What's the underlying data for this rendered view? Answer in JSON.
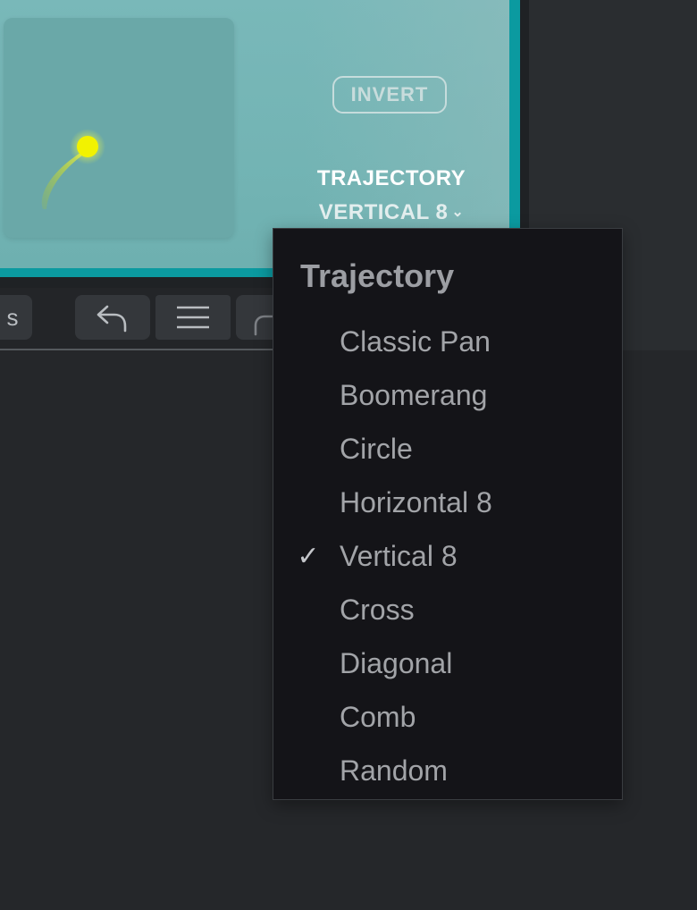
{
  "panel": {
    "invert_label": "INVERT",
    "trajectory_label": "TRAJECTORY",
    "trajectory_value": "VERTICAL 8",
    "chevron": "⌄"
  },
  "toolbar": {
    "left_button_text": "s",
    "icons": [
      "undo-arrow-icon",
      "hamburger-menu-icon",
      "curve-icon"
    ]
  },
  "dropdown": {
    "title": "Trajectory",
    "selected": "Vertical 8",
    "check_glyph": "✓",
    "items": [
      {
        "label": "Classic Pan"
      },
      {
        "label": "Boomerang"
      },
      {
        "label": "Circle"
      },
      {
        "label": "Horizontal 8"
      },
      {
        "label": "Vertical 8"
      },
      {
        "label": "Cross"
      },
      {
        "label": "Diagonal"
      },
      {
        "label": "Comb"
      },
      {
        "label": "Random"
      }
    ]
  },
  "colors": {
    "panel_teal": "#0b9aa0",
    "panel_bg": "#79b8b9",
    "pad_bg": "#6aa8a8",
    "dot_yellow": "#f2f200",
    "trail": "#b7d14a",
    "menu_bg": "#141418",
    "app_bg": "#25272a"
  }
}
